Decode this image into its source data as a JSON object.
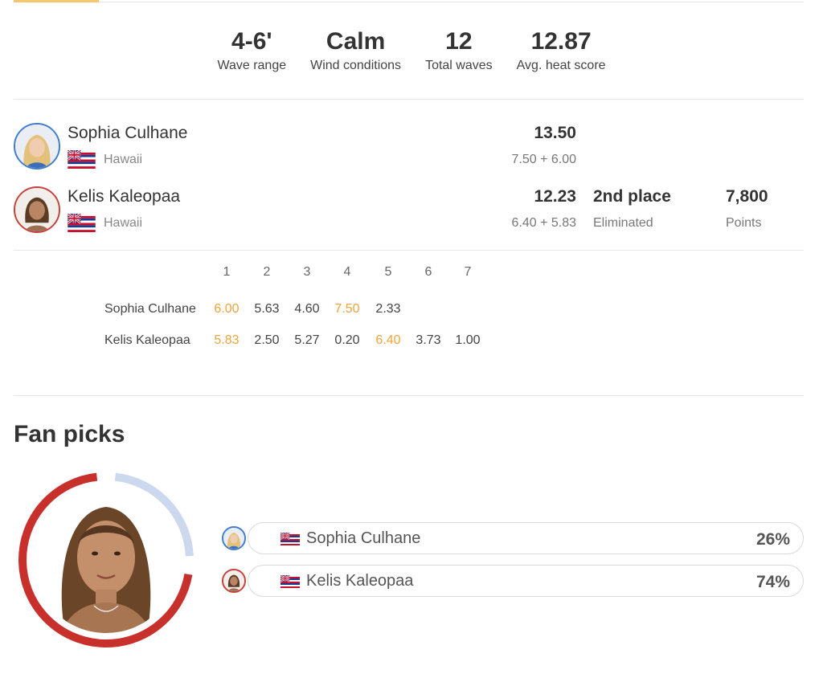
{
  "stats": [
    {
      "value": "4-6'",
      "label": "Wave range"
    },
    {
      "value": "Calm",
      "label": "Wind conditions"
    },
    {
      "value": "12",
      "label": "Total waves"
    },
    {
      "value": "12.87",
      "label": "Avg. heat score"
    }
  ],
  "athletes": [
    {
      "name": "Sophia Culhane",
      "country": "Hawaii",
      "total": "13.50",
      "breakdown": "7.50 + 6.00",
      "place": "",
      "result": "",
      "points": "",
      "points_label": "",
      "ring_color": "#3f7dd0"
    },
    {
      "name": "Kelis Kaleopaa",
      "country": "Hawaii",
      "total": "12.23",
      "breakdown": "6.40 + 5.83",
      "place": "2nd place",
      "result": "Eliminated",
      "points": "7,800",
      "points_label": "Points",
      "ring_color": "#c8403a"
    }
  ],
  "wave_table": {
    "headers": [
      "1",
      "2",
      "3",
      "4",
      "5",
      "6",
      "7"
    ],
    "rows": [
      {
        "name": "Sophia Culhane",
        "scores": [
          "6.00",
          "5.63",
          "4.60",
          "7.50",
          "2.33",
          "",
          ""
        ],
        "best": [
          0,
          3
        ]
      },
      {
        "name": "Kelis Kaleopaa",
        "scores": [
          "5.83",
          "2.50",
          "5.27",
          "0.20",
          "6.40",
          "3.73",
          "1.00"
        ],
        "best": [
          0,
          4
        ]
      }
    ]
  },
  "fan_picks": {
    "title": "Fan picks",
    "picks": [
      {
        "name": "Sophia Culhane",
        "percent": "26%",
        "share": 0.26,
        "color": "#ccd8ee"
      },
      {
        "name": "Kelis Kaleopaa",
        "percent": "74%",
        "share": 0.74,
        "color": "#c8302c"
      }
    ]
  },
  "colors": {
    "accent": "#f5c66e",
    "best_wave": "#f0a43a",
    "blue": "#3f7dd0",
    "red": "#c8403a"
  }
}
